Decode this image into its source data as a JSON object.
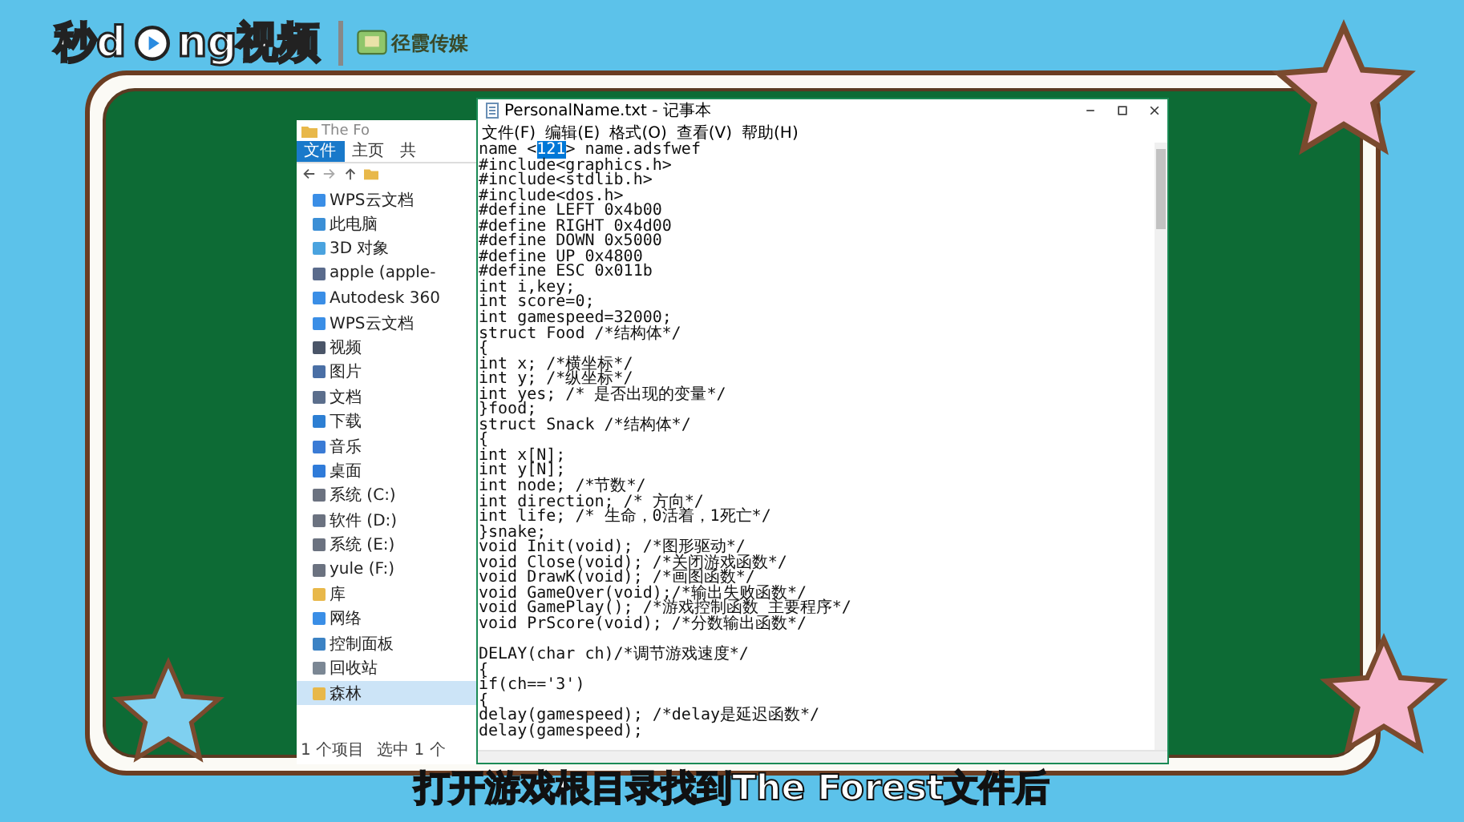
{
  "logo": {
    "before_icon": "秒d",
    "after_icon": "ng视频"
  },
  "brand": "径霞传媒",
  "explorer": {
    "title": "The Fo",
    "ribbon_tabs": [
      {
        "label": "文件",
        "selected": true
      },
      {
        "label": "主页",
        "selected": false
      },
      {
        "label": "共",
        "selected": false
      }
    ],
    "nav_items": [
      {
        "label": "WPS云文档",
        "selected": false
      },
      {
        "label": "此电脑",
        "selected": false
      },
      {
        "label": "3D 对象",
        "selected": false
      },
      {
        "label": "apple (apple-",
        "selected": false
      },
      {
        "label": "Autodesk 360",
        "selected": false
      },
      {
        "label": "WPS云文档",
        "selected": false
      },
      {
        "label": "视频",
        "selected": false
      },
      {
        "label": "图片",
        "selected": false
      },
      {
        "label": "文档",
        "selected": false
      },
      {
        "label": "下载",
        "selected": false
      },
      {
        "label": "音乐",
        "selected": false
      },
      {
        "label": "桌面",
        "selected": false
      },
      {
        "label": "系统 (C:)",
        "selected": false
      },
      {
        "label": "软件 (D:)",
        "selected": false
      },
      {
        "label": "系统 (E:)",
        "selected": false
      },
      {
        "label": "yule (F:)",
        "selected": false
      },
      {
        "label": "库",
        "selected": false
      },
      {
        "label": "网络",
        "selected": false
      },
      {
        "label": "控制面板",
        "selected": false
      },
      {
        "label": "回收站",
        "selected": false
      },
      {
        "label": "森林",
        "selected": true
      }
    ],
    "status": [
      "1 个项目",
      "选中 1 个"
    ]
  },
  "notepad": {
    "title": "PersonalName.txt - 记事本",
    "menu": [
      "文件(F)",
      "编辑(E)",
      "格式(O)",
      "查看(V)",
      "帮助(H)"
    ],
    "first_line": [
      {
        "text": "name <",
        "selected": false
      },
      {
        "text": "121",
        "selected": true
      },
      {
        "text": "> name.adsfwef",
        "selected": false
      }
    ],
    "line_groups": [
      [
        "#include<graphics.h>",
        "#include<stdlib.h>",
        "#include<dos.h>",
        "#define LEFT 0x4b00",
        "#define RIGHT 0x4d00",
        "#define DOWN 0x5000",
        "#define UP 0x4800",
        "#define ESC 0x011b",
        "int i,key;",
        "int score=0;",
        "int gamespeed=32000;",
        "struct Food /*结构体*/",
        "{",
        "int x; /*横坐标*/",
        "int y; /*纵坐标*/",
        "int yes; /* 是否出现的变量*/",
        "}food;",
        "struct Snack /*结构体*/",
        "{",
        "int x[N];",
        "int y[N];",
        "int node; /*节数*/",
        "int direction; /* 方向*/",
        "int life; /* 生命，0活着，1死亡*/",
        "}snake;",
        "void Init(void); /*图形驱动*/",
        "void Close(void); /*关闭游戏函数*/",
        "void DrawK(void); /*画图函数*/",
        "void GameOver(void);/*输出失败函数*/",
        "void GamePlay(); /*游戏控制函数 主要程序*/",
        "void PrScore(void); /*分数输出函数*/"
      ],
      [
        "DELAY(char ch)/*调节游戏速度*/",
        "{",
        "if(ch=='3')",
        "{",
        "delay(gamespeed); /*delay是延迟函数*/",
        "delay(gamespeed);"
      ]
    ]
  },
  "subtitle": "打开游戏根目录找到The Forest文件后"
}
